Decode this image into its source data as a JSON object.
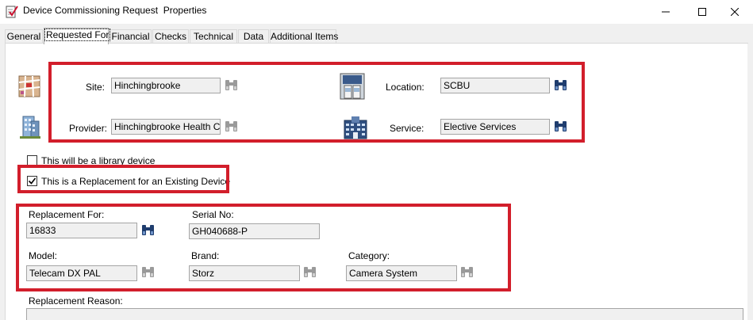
{
  "window": {
    "title": "Device Commissioning Request  Properties",
    "minimize_glyph": "—",
    "maximize_glyph": "☐",
    "close_glyph": "✕"
  },
  "tabs": [
    {
      "label": "General",
      "active": false
    },
    {
      "label": "Requested For",
      "active": true
    },
    {
      "label": "Financial",
      "active": false
    },
    {
      "label": "Checks",
      "active": false
    },
    {
      "label": "Technical",
      "active": false
    },
    {
      "label": "Data",
      "active": false
    },
    {
      "label": "Additional Items",
      "active": false
    }
  ],
  "site": {
    "label": "Site:",
    "value": "Hinchingbrooke"
  },
  "provider": {
    "label": "Provider:",
    "value": "Hinchingbrooke Health Care"
  },
  "location": {
    "label": "Location:",
    "value": "SCBU"
  },
  "service": {
    "label": "Service:",
    "value": "Elective Services"
  },
  "library_device": {
    "label": "This will be a library device",
    "checked": false
  },
  "replacement_check": {
    "label": "This is a Replacement for an Existing Device",
    "checked": true
  },
  "replacement_for": {
    "label": "Replacement For:",
    "value": "16833"
  },
  "serial_no": {
    "label": "Serial No:",
    "value": "GH040688-P"
  },
  "model": {
    "label": "Model:",
    "value": "Telecam DX PAL"
  },
  "brand": {
    "label": "Brand:",
    "value": "Storz"
  },
  "category": {
    "label": "Category:",
    "value": "Camera System"
  },
  "replacement_reason": {
    "label": "Replacement Reason:",
    "value": ""
  },
  "colors": {
    "highlight_border": "#d21e2b",
    "field_background": "#f0f0f0",
    "panel_background": "#ffffff"
  },
  "icons": {
    "app": "checklist-icon",
    "site": "map-icon",
    "provider": "building-icon",
    "location": "ward-door-icon",
    "service": "hospital-building-icon",
    "lookup": "binoculars-icon"
  }
}
